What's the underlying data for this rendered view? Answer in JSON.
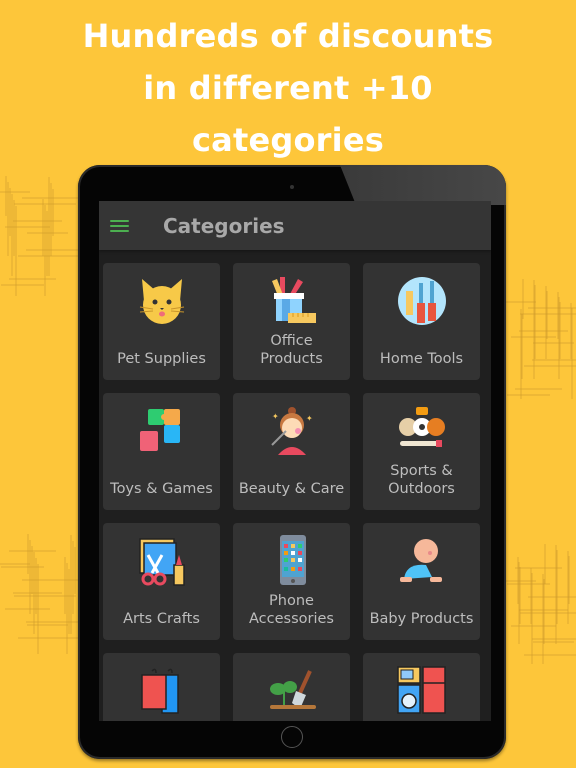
{
  "headline": [
    "Hundreds of discounts",
    "in different +10",
    "categories"
  ],
  "app": {
    "title": "Categories",
    "menu_icon": "hamburger-menu-icon"
  },
  "categories": [
    {
      "label": "Pet Supplies",
      "icon": "cat-icon"
    },
    {
      "label": "Office Products",
      "icon": "pencil-cup-icon"
    },
    {
      "label": "Home Tools",
      "icon": "tools-icon"
    },
    {
      "label": "Toys & Games",
      "icon": "puzzle-icon"
    },
    {
      "label": "Beauty & Care",
      "icon": "makeup-woman-icon"
    },
    {
      "label": "Sports & Outdoors",
      "icon": "sports-balls-icon"
    },
    {
      "label": "Arts Crafts",
      "icon": "canvas-scissors-icon"
    },
    {
      "label": "Phone Accessories",
      "icon": "smartphone-icon"
    },
    {
      "label": "Baby Products",
      "icon": "crawling-baby-icon"
    },
    {
      "label": "",
      "icon": "clothes-hanger-icon"
    },
    {
      "label": "",
      "icon": "garden-shovel-icon"
    },
    {
      "label": "",
      "icon": "appliances-icon"
    }
  ],
  "colors": {
    "background": "#fdc63a",
    "accent": "#4caf50",
    "card": "#333333",
    "appbar": "#353535"
  }
}
